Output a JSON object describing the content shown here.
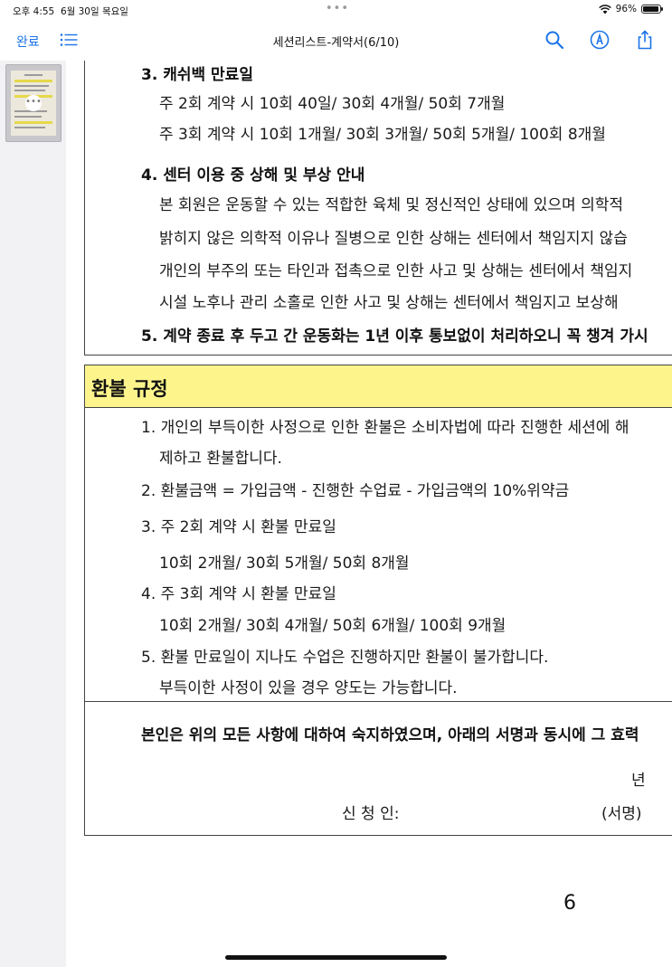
{
  "status_bar": {
    "time": "오후 4:55",
    "date": "6월 30일 목요일",
    "battery": "96%",
    "battery_level": 0.96
  },
  "toolbar": {
    "done_label": "완료",
    "title": "세션리스트-계약서(6/10)",
    "icons": [
      "list-icon",
      "search-icon",
      "markup-icon",
      "share-icon"
    ]
  },
  "sidebar": {
    "thumbnail_more": "•••"
  },
  "document": {
    "sections": {
      "cashback": {
        "heading": "3. 캐쉬백 만료일",
        "line1": "주 2회 계약 시 10회 40일/ 30회 4개월/ 50회 7개월",
        "line2": "주 3회 계약 시 10회 1개월/ 30회 3개월/ 50회 5개월/ 100회 8개월"
      },
      "injury": {
        "heading": "4. 센터 이용 중 상해 및 부상 안내",
        "lines": [
          "본 회원은 운동할 수 있는 적합한 육체 및 정신적인 상태에 있으며 의학적",
          "밝히지 않은 의학적 이유나 질병으로 인한 상해는 센터에서 책임지지 않습",
          "개인의 부주의 또는 타인과 접촉으로 인한 사고 및 상해는 센터에서 책임지",
          "시설 노후나 관리 소홀로 인한 사고 및 상해는 센터에서 책임지고 보상해 "
        ]
      },
      "shoes": {
        "heading": "5. 계약 종료 후 두고 간 운동화는 1년 이후 통보없이 처리하오니 꼭 챙겨 가시"
      }
    },
    "refund": {
      "title": "환불 규정",
      "lines": [
        "1. 개인의 부득이한 사정으로 인한 환불은 소비자법에 따라 진행한 세션에 해",
        "제하고 환불합니다.",
        "2. 환불금액 = 가입금액 - 진행한 수업료 - 가입금액의 10%위약금",
        "3. 주 2회 계약 시 환불 만료일",
        "10회 2개월/ 30회 5개월/ 50회 8개월",
        "4. 주 3회 계약 시 환불 만료일",
        "10회 2개월/ 30회 4개월/ 50회 6개월/ 100회 9개월",
        "5. 환불 만료일이 지나도 수업은 진행하지만 환불이 불가합니다.",
        "부득이한 사정이 있을 경우 양도는 가능합니다."
      ]
    },
    "agreement": {
      "statement": "본인은 위의 모든 사항에 대하여 숙지하였으며, 아래의 서명과 동시에 그 효력",
      "year_label": "년",
      "applicant_label": "신 청 인:",
      "signature_label": "(서명)"
    },
    "page_number": "6"
  }
}
